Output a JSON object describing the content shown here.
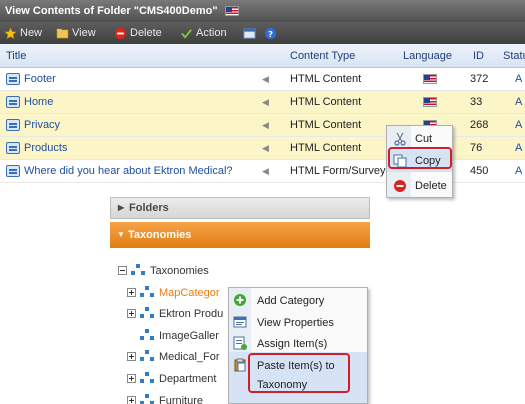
{
  "window": {
    "title": "View Contents of Folder \"CMS400Demo\""
  },
  "toolbar": {
    "new_label": "New",
    "view_label": "View",
    "delete_label": "Delete",
    "action_label": "Action"
  },
  "columns": {
    "title": "Title",
    "content_type": "Content Type",
    "language": "Language",
    "id": "ID",
    "status": "Statu"
  },
  "rows": [
    {
      "title": "Footer",
      "type": "HTML Content",
      "id": "372",
      "status": "A"
    },
    {
      "title": "Home",
      "type": "HTML Content",
      "id": "33",
      "status": "A"
    },
    {
      "title": "Privacy",
      "type": "HTML Content",
      "id": "268",
      "status": "A"
    },
    {
      "title": "Products",
      "type": "HTML Content",
      "id": "76",
      "status": "A"
    },
    {
      "title": "Where did you hear about Ektron Medical?",
      "type": "HTML Form/Survey",
      "id": "450",
      "status": "A"
    }
  ],
  "context_menu_top": {
    "cut": "Cut",
    "copy": "Copy",
    "delete": "Delete"
  },
  "panels": {
    "folders": "Folders",
    "taxonomies": "Taxonomies"
  },
  "tree": {
    "root": "Taxonomies",
    "nodes": [
      "MapCategor",
      "Ektron Produ",
      "ImageGaller",
      "Medical_For",
      "Department",
      "Furniture"
    ]
  },
  "context_menu_bottom": {
    "add_category": "Add Category",
    "view_properties": "View Properties",
    "assign_items": "Assign Item(s)",
    "paste_line1": "Paste Item(s) to",
    "paste_line2": "Taxonomy"
  },
  "colors": {
    "highlight": "#fbf5c8",
    "accent_orange": "#e27d12",
    "link_blue": "#1d4fa0",
    "callout_red": "#d01e2a"
  }
}
